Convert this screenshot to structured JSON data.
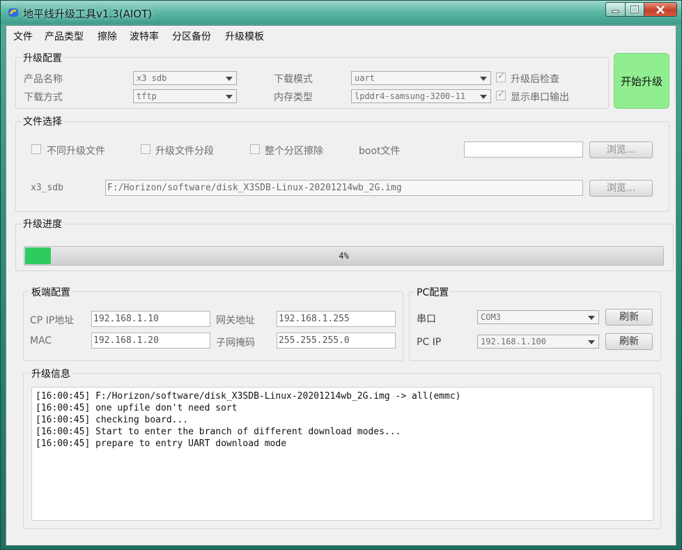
{
  "window": {
    "title": "地平线升级工具v1.3(AIOT)"
  },
  "menu": [
    "文件",
    "产品类型",
    "擦除",
    "波特率",
    "分区备份",
    "升级模板"
  ],
  "upgrade_config": {
    "title": "升级配置",
    "product_name_label": "产品名称",
    "product_name_value": "x3 sdb",
    "download_method_label": "下载方式",
    "download_method_value": "tftp",
    "download_mode_label": "下载模式",
    "download_mode_value": "uart",
    "memory_type_label": "内存类型",
    "memory_type_value": "lpddr4-samsung-3200-11",
    "check_after_upgrade_label": "升级后检查",
    "check_after_upgrade": true,
    "show_serial_output_label": "显示串口输出",
    "show_serial_output": true
  },
  "start_button": {
    "label": "开始升级",
    "color": "#90ee90"
  },
  "file_select": {
    "title": "文件选择",
    "different_files_label": "不同升级文件",
    "file_segments_label": "升级文件分段",
    "full_erase_label": "整个分区擦除",
    "boot_file_label": "boot文件",
    "boot_file_value": "",
    "browse_label": "浏览...",
    "image_label": "x3_sdb",
    "image_path": "F:/Horizon/software/disk_X3SDB-Linux-20201214wb_2G.img",
    "browse2_label": "浏览..."
  },
  "progress": {
    "title": "升级进度",
    "percent": 4,
    "text": "4%",
    "color": "#2ecc5f"
  },
  "board_config": {
    "title": "板端配置",
    "cp_ip_label": "CP IP地址",
    "cp_ip": "192.168.1.10",
    "gateway_label": "网关地址",
    "gateway": "192.168.1.255",
    "mac_label": "MAC",
    "mac": "192.168.1.20",
    "subnet_label": "子网掩码",
    "subnet": "255.255.255.0"
  },
  "pc_config": {
    "title": "PC配置",
    "serial_label": "串口",
    "serial_value": "COM3",
    "refresh_label": "刷新",
    "pc_ip_label": "PC IP",
    "pc_ip_value": "192.168.1.100",
    "refresh2_label": "刷新"
  },
  "upgrade_info": {
    "title": "升级信息",
    "log": [
      "[16:00:45] F:/Horizon/software/disk_X3SDB-Linux-20201214wb_2G.img -> all(emmc)",
      "[16:00:45] one upfile don't need sort",
      "[16:00:45] checking board...",
      "[16:00:45] Start to enter the branch of different download modes...",
      "[16:00:45] prepare to entry UART download mode"
    ]
  }
}
